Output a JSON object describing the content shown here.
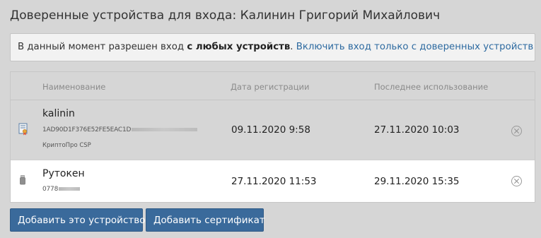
{
  "page": {
    "title": "Доверенные устройства для входа: Калинин Григорий Михайлович"
  },
  "notice": {
    "prefix": "В данный момент разрешен вход ",
    "emphasis": "с любых устройств",
    "suffix": ". ",
    "link": "Включить вход только с доверенных устройств"
  },
  "table": {
    "headers": {
      "name": "Наименование",
      "registered": "Дата регистрации",
      "last_used": "Последнее использование"
    },
    "rows": [
      {
        "icon": "certificate-icon",
        "name": "kalinin",
        "serial": "1AD90D1F376E52FE5EAC1D",
        "provider": "КриптоПро CSP",
        "registered": "09.11.2020 9:58",
        "last_used": "27.11.2020 10:03"
      },
      {
        "icon": "usb-token-icon",
        "name": "Рутокен",
        "serial": "0778",
        "registered": "27.11.2020 11:53",
        "last_used": "29.11.2020 15:35"
      }
    ]
  },
  "buttons": {
    "add_device": "Добавить это устройство",
    "add_certificate": "Добавить сертификат"
  },
  "colors": {
    "background": "#d6d6d6",
    "link": "#2d6aa0",
    "button": "#3a6a9b",
    "selected_row": "#ffffff"
  }
}
